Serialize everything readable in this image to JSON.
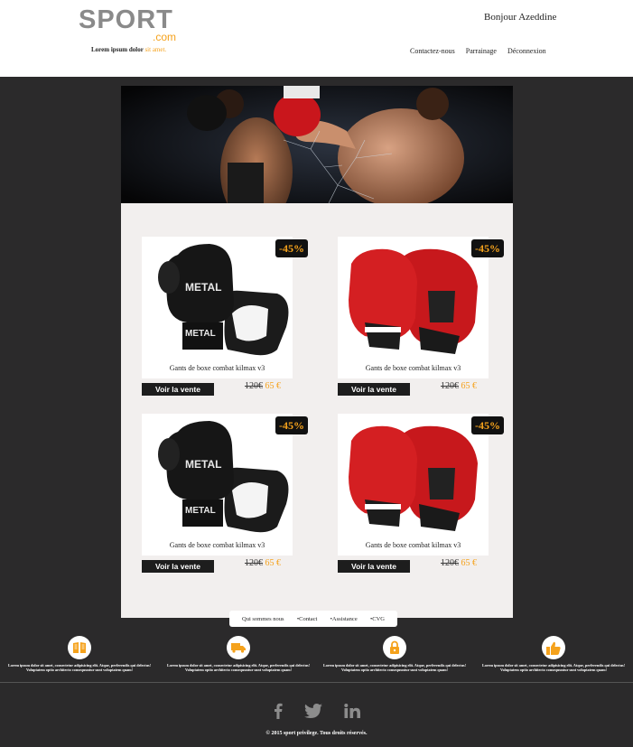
{
  "header": {
    "logo_main": "SPORT",
    "logo_sub": ".com",
    "tagline_text": "Lorem ipsum dolor",
    "tagline_accent": "sit amet.",
    "greeting": "Bonjour Azeddine",
    "nav": [
      "Contactez-nous",
      "Parrainage",
      "Déconnexion"
    ]
  },
  "products": [
    {
      "name": "Gants de boxe combat kilmax v3",
      "badge": "-45%",
      "button": "Voir la vente",
      "old_price": "120€",
      "new_price": "65 €",
      "color": "black"
    },
    {
      "name": "Gants de boxe combat kilmax v3",
      "badge": "-45%",
      "button": "Voir la vente",
      "old_price": "120€",
      "new_price": "65 €",
      "color": "red"
    },
    {
      "name": "Gants de boxe combat kilmax v3",
      "badge": "-45%",
      "button": "Voir la vente",
      "old_price": "120€",
      "new_price": "65 €",
      "color": "black"
    },
    {
      "name": "Gants de boxe combat kilmax v3",
      "badge": "-45%",
      "button": "Voir la vente",
      "old_price": "120€",
      "new_price": "65 €",
      "color": "red"
    }
  ],
  "footer": {
    "nav": [
      "Qui sommes nous",
      "•Contact",
      "•Assistance",
      "•CVG"
    ],
    "features": [
      {
        "icon": "book-icon",
        "text": "Lorem ipsum dolor sit amet, consectetur adipisicing elit. Atque, perferendis qui delectus! Voluptatem optio architecto consequuntur sunt voluptatem quam!"
      },
      {
        "icon": "truck-icon",
        "text": "Lorem ipsum dolor sit amet, consectetur adipisicing elit. Atque, perferendis qui delectus! Voluptatem optio architecto consequuntur sunt voluptatem quam!"
      },
      {
        "icon": "lock-icon",
        "text": "Lorem ipsum dolor sit amet, consectetur adipisicing elit. Atque, perferendis qui delectus! Voluptatem optio architecto consequuntur sunt voluptatem quam!"
      },
      {
        "icon": "thumbs-up-icon",
        "text": "Lorem ipsum dolor sit amet, consectetur adipisicing elit. Atque, perferendis qui delectus! Voluptatem optio architecto consequuntur sunt voluptatem quam!"
      }
    ],
    "social": [
      "facebook-icon",
      "twitter-icon",
      "linkedin-icon"
    ],
    "copyright": "© 2015 sport privilege. Tous droits réservés."
  },
  "colors": {
    "accent": "#f5a21c",
    "background": "#2b2a2b",
    "panel": "#f2efee"
  }
}
